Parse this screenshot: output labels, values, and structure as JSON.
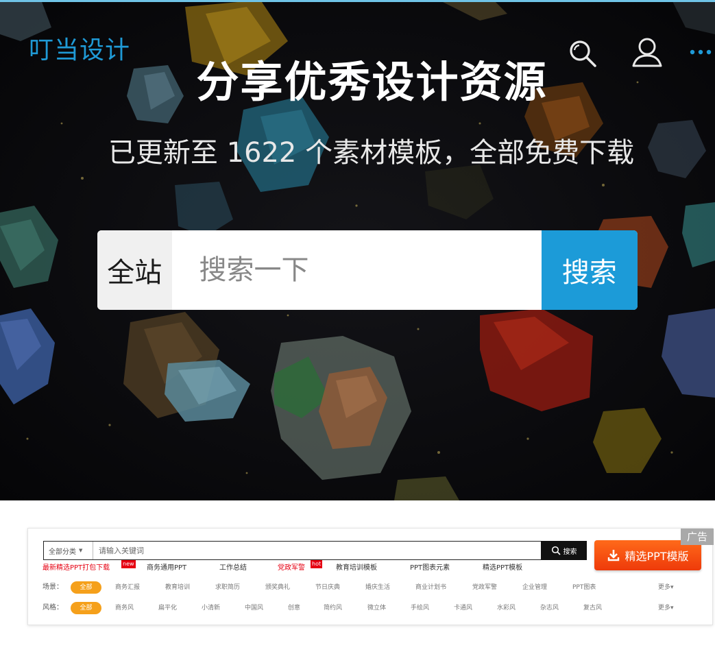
{
  "header": {
    "logo": "叮当设计",
    "title": "分享优秀设计资源",
    "subtitle": "已更新至  1622  个素材模板，全部免费下载"
  },
  "icons": {
    "search": "search-icon",
    "user": "user-icon",
    "more": "more-icon",
    "download": "download-icon"
  },
  "colors": {
    "accent": "#1c9bd8",
    "logo": "#1f9ad6",
    "orange": "#f5a01b",
    "ad_button": "#ef4710",
    "hot_red": "#e60012"
  },
  "search": {
    "scope": "全站",
    "placeholder": "搜索一下",
    "button": "搜索"
  },
  "panel": {
    "ad_tag": "广告",
    "category_select": "全部分类",
    "keyword_placeholder": "请输入关键词",
    "search_button": "搜索",
    "ppt_button": "精选PPT模版",
    "quick_links": [
      {
        "label": "最新精选PPT打包下载",
        "badge": "new"
      },
      {
        "label": "商务通用PPT"
      },
      {
        "label": "工作总结"
      },
      {
        "label": "党政军警",
        "badge": "hot"
      },
      {
        "label": "教育培训模板"
      },
      {
        "label": "PPT图表元素"
      },
      {
        "label": "精选PPT模板"
      }
    ],
    "scene": {
      "label": "场景：",
      "active": "全部",
      "options": [
        "商务汇报",
        "教育培训",
        "求职简历",
        "颁奖典礼",
        "节日庆典",
        "婚庆生活",
        "商业计划书",
        "党政军警",
        "企业管理",
        "PPT图表"
      ],
      "more": "更多▾"
    },
    "style": {
      "label": "风格：",
      "active": "全部",
      "options": [
        "商务风",
        "扁平化",
        "小清新",
        "中国风",
        "创意",
        "简约风",
        "微立体",
        "手绘风",
        "卡通风",
        "水彩风",
        "杂志风",
        "复古风"
      ],
      "more": "更多▾"
    }
  }
}
